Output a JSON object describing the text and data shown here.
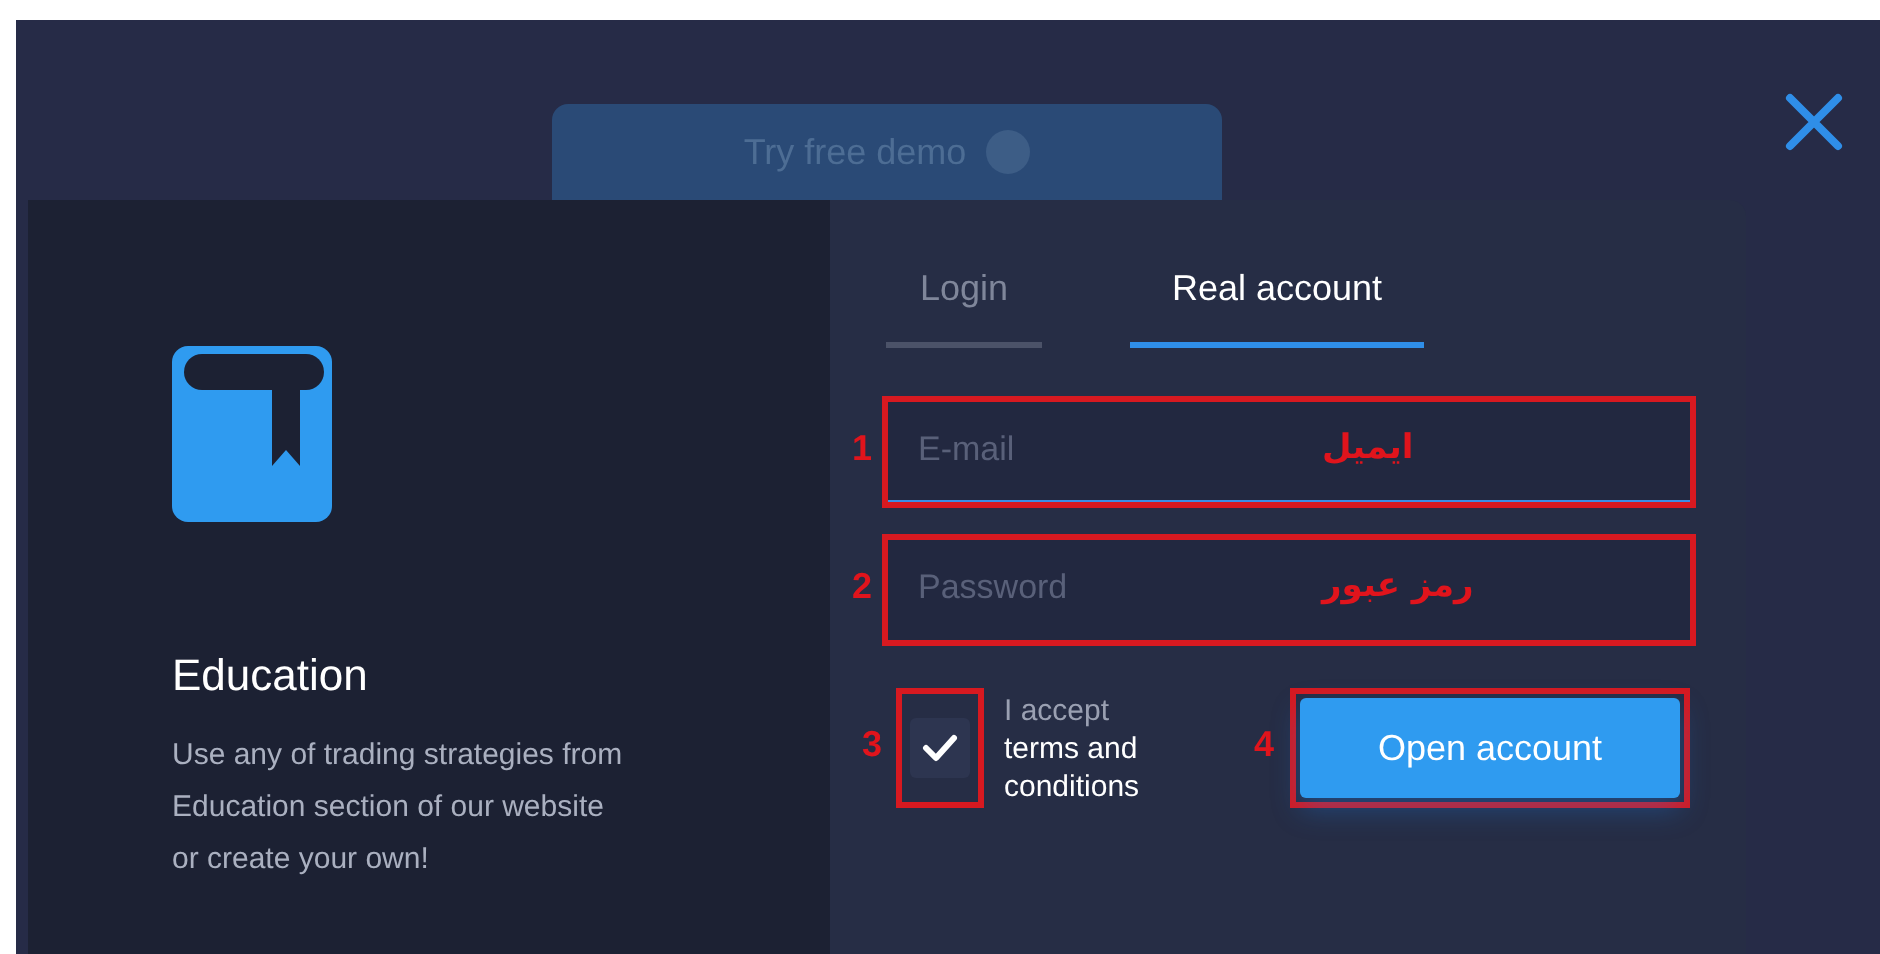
{
  "demo_button": {
    "label": "Try free demo"
  },
  "info": {
    "title": "Education",
    "text": "Use any of trading strategies from Education section of our website or create your own!"
  },
  "tabs": [
    {
      "label": "Login",
      "selected": false
    },
    {
      "label": "Real account",
      "selected": true
    }
  ],
  "fields": [
    {
      "placeholder": "E-mail",
      "focused": true,
      "annotation_number": "1",
      "annotation_label": "ایمیل"
    },
    {
      "placeholder": "Password",
      "focused": false,
      "annotation_number": "2",
      "annotation_label": "رمز عبور"
    }
  ],
  "terms": {
    "checked": true,
    "prefix": "I accept",
    "link": "terms and conditions",
    "annotation_number": "3"
  },
  "submit": {
    "label": "Open account",
    "annotation_number": "4"
  }
}
